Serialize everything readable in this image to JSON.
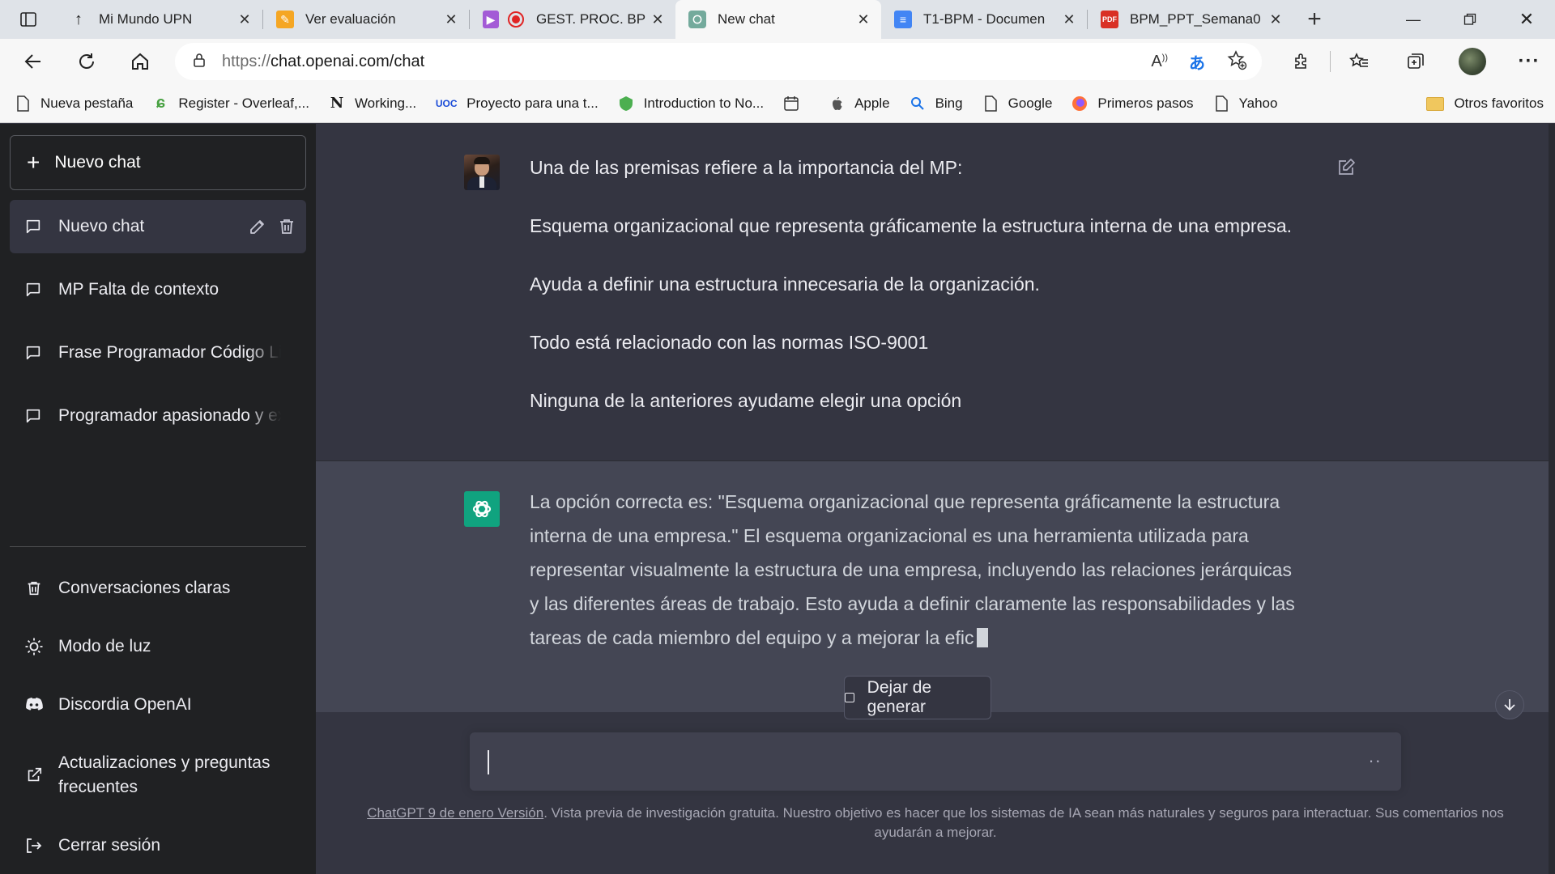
{
  "browser": {
    "tabs": [
      {
        "title": "Mi Mundo UPN",
        "icon": "upn-icon",
        "active": false
      },
      {
        "title": "Ver evaluación",
        "icon": "pencil-page-icon",
        "active": false
      },
      {
        "title": "GEST. PROC. BP",
        "icon": "record-icon",
        "active": false
      },
      {
        "title": "New chat",
        "icon": "openai-icon",
        "active": true
      },
      {
        "title": "T1-BPM - Documen",
        "icon": "docs-icon",
        "active": false
      },
      {
        "title": "BPM_PPT_Semana0",
        "icon": "pdf-icon",
        "active": false
      }
    ],
    "url_prefix": "https://",
    "url_rest": "chat.openai.com/chat",
    "bookmarks": [
      {
        "label": "Nueva pestaña",
        "icon": "page-icon"
      },
      {
        "label": "Register - Overleaf,...",
        "icon": "overleaf-icon"
      },
      {
        "label": "Working...",
        "icon": "notion-icon"
      },
      {
        "label": "Proyecto para una t...",
        "icon": "uoc-icon"
      },
      {
        "label": "Introduction to No...",
        "icon": "shield-icon"
      },
      {
        "label": "",
        "icon": "calendar-icon"
      },
      {
        "label": "Apple",
        "icon": "apple-icon"
      },
      {
        "label": "Bing",
        "icon": "search-icon"
      },
      {
        "label": "Google",
        "icon": "page-icon"
      },
      {
        "label": "Primeros pasos",
        "icon": "firefox-icon"
      },
      {
        "label": "Yahoo",
        "icon": "page-icon"
      }
    ],
    "other_favorites": "Otros favoritos"
  },
  "sidebar": {
    "new_chat": "Nuevo chat",
    "chats": [
      {
        "label": "Nuevo chat",
        "active": true
      },
      {
        "label": "MP Falta de contexto",
        "active": false
      },
      {
        "label": "Frase Programador Código Li",
        "active": false
      },
      {
        "label": "Programador apasionado y ex",
        "active": false
      }
    ],
    "bottom": [
      {
        "label": "Conversaciones claras",
        "icon": "trash-icon"
      },
      {
        "label": "Modo de luz",
        "icon": "sun-icon"
      },
      {
        "label": "Discordia OpenAI",
        "icon": "discord-icon"
      },
      {
        "label": "Actualizaciones y preguntas frecuentes",
        "icon": "external-link-icon"
      },
      {
        "label": "Cerrar sesión",
        "icon": "logout-icon"
      }
    ]
  },
  "conversation": {
    "user_lines": [
      "Una de las premisas refiere a la importancia del MP:",
      "Esquema organizacional que representa gráficamente la estructura interna de una empresa.",
      "Ayuda a definir una estructura innecesaria de la organización.",
      "Todo está relacionado con las normas ISO-9001",
      "Ninguna de la anteriores ayudame elegir una opción"
    ],
    "bot_lines": [
      "La opción correcta es: \"Esquema organizacional que representa gráficamente la estructura",
      "interna de una empresa.\" El esquema organizacional es una herramienta utilizada para",
      "representar visualmente la estructura de una empresa, incluyendo las relaciones jerárquicas",
      "y las diferentes áreas de trabajo. Esto ayuda a definir claramente las responsabilidades y las",
      "tareas de cada miembro del equipo y a mejorar la efic"
    ]
  },
  "stop_button": "Dejar de generar",
  "input": {
    "dots": "··"
  },
  "footer": {
    "link": "ChatGPT 9 de enero Versión",
    "text": ". Vista previa de investigación gratuita. Nuestro objetivo es hacer que los sistemas de IA sean más naturales y seguros para interactuar. Sus comentarios nos ayudarán a mejorar."
  },
  "colors": {
    "sidebar": "#202123",
    "main": "#343541",
    "bot_bg": "#444654",
    "accent": "#10a37f"
  }
}
